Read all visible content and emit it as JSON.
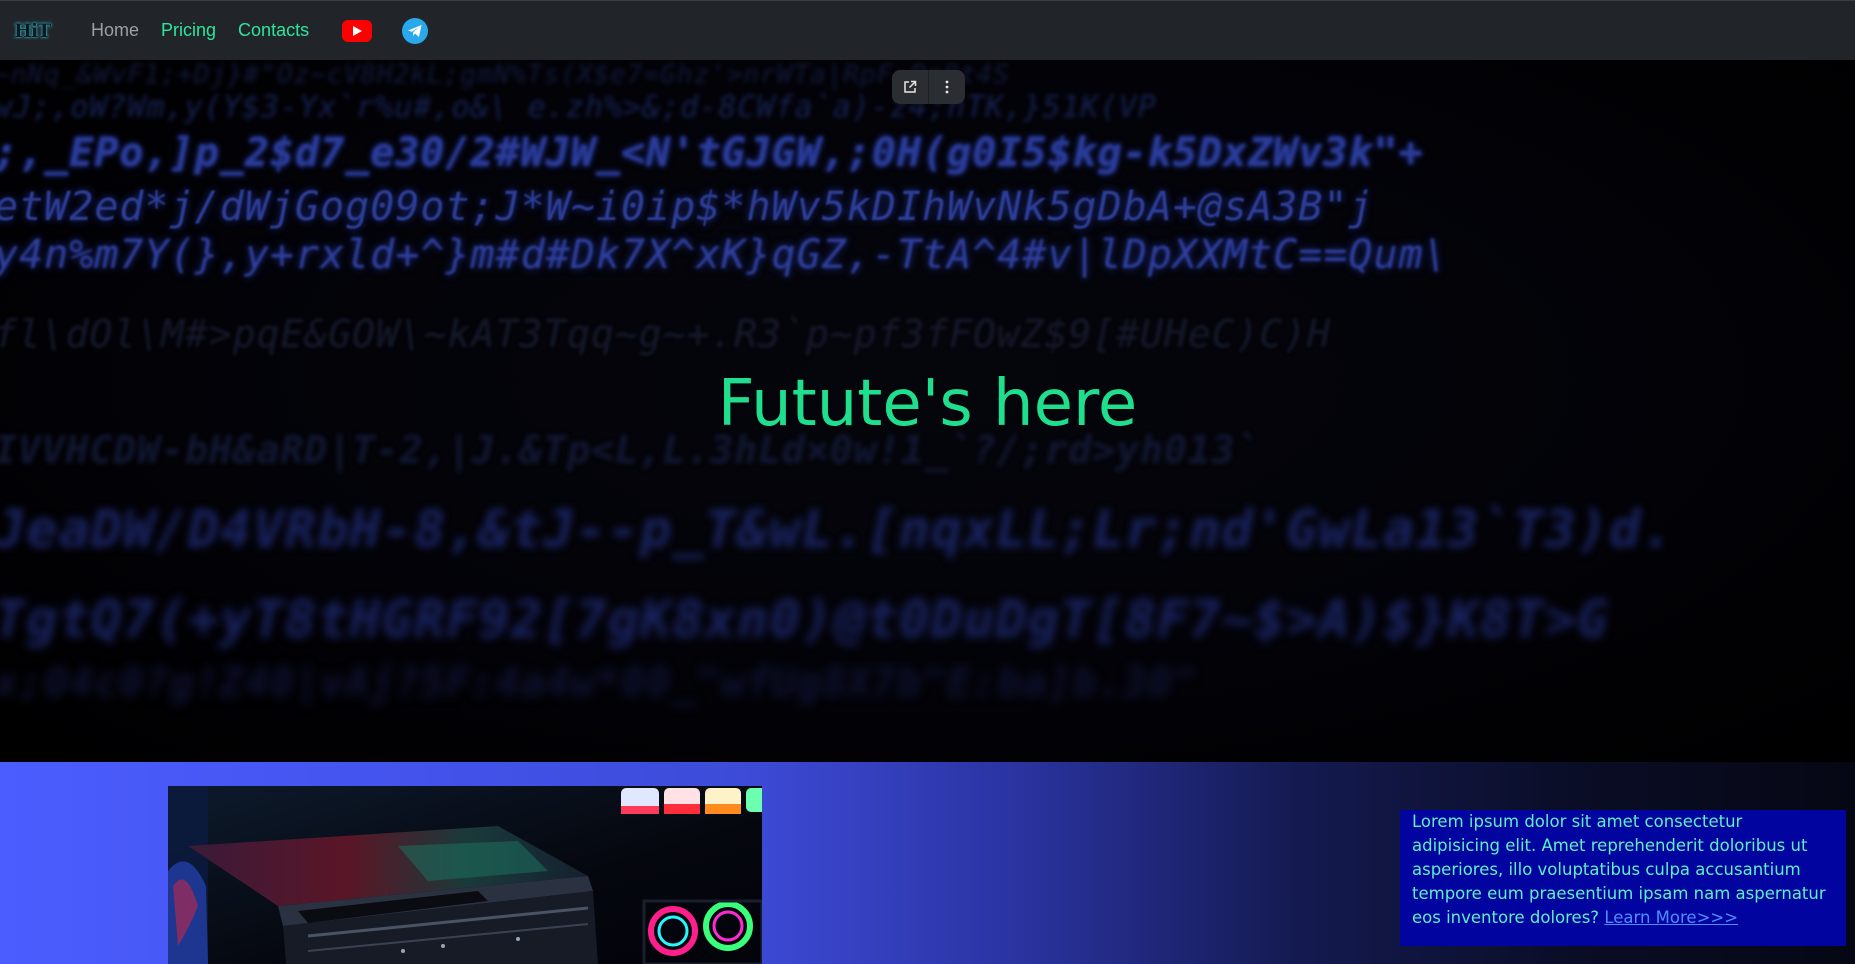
{
  "navbar": {
    "logo_text": "HiT",
    "links": [
      "Home",
      "Pricing",
      "Contacts"
    ],
    "social": [
      "youtube-icon",
      "telegram-icon"
    ],
    "colors": {
      "background": "#212529",
      "active_link": "#2ee59d",
      "link": "#9aa0a6"
    }
  },
  "hero": {
    "title": "Futute's here",
    "title_color": "#1fdf8f",
    "code_lines": [
      "~nNq_&WvF1;+Dj}#\"Oz~cV8H2kL;gmN%Ts(X$e7=Ghz'>nrWTa|RpF:Pn8t4S",
      "wJ;,oW?Wm,y(Y$3-Yx`r%u#,o&\\ e.zh%>&;d-8CWfa`a)-z4;hTK,}51K(VP",
      ";,_EPo,]p_2$d7_e30/2#WJW_<N'tGJGW,;0H(g0I5$kg-k5DxZWv3k\"+",
      "etW2ed*j/dWjGog09ot;J*W~i0ip$*hWv5kDIhWvNk5gDbA+@sA3B\"j",
      "y4n%m7Y(},y+rxld+^}m#d#Dk7X^xK}qGZ,-TtA^4#v|lDpXXMtC==Qum\\",
      "fl\\dOl\\M#>pqE&GOW\\~kAT3Tqq~g~+.R3`p~pf3fFOwZ$9[#UHeC)C)H",
      "IVVHCDW-bH&aRD|T-2,|J.&Tp<L,L.3hLd×0w!1_`?/;rd>yh013`",
      "JeaDW/D4VRbH-8,&tJ--p_T&wL.[nqxLL;Lr;nd'GwLa13`T3)d.",
      "TgtQ7(+yT8tHGRF92[7gK8xn0)@t0DuDgT[8F7~$>A)$}K8T>G",
      "x;04c0?g!Z40|vAj?5F:4a4w*00_\"wfUg8X7b\"E:ba]b.30\""
    ]
  },
  "toolbar": {
    "icons": [
      "open-external-icon",
      "more-vertical-icon"
    ]
  },
  "info": {
    "text": "Lorem ipsum dolor sit amet consectetur adipisicing elit. Amet reprehenderit doloribus ut asperiores, illo voluptatibus culpa accusantium tempore eum praesentium ipsam nam aspernatur eos inventore dolores?",
    "link_text": "Learn More>>>",
    "text_color": "#5cf0c8",
    "link_color": "#4f8dff",
    "background": "#0204a0"
  }
}
